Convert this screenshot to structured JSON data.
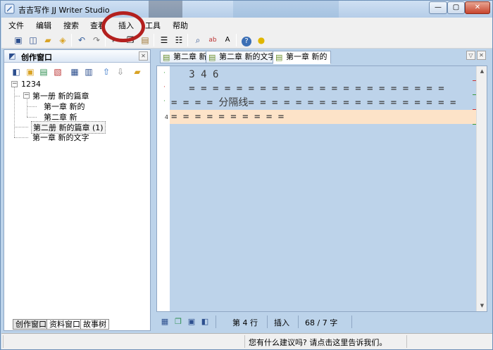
{
  "app": {
    "title": "吉吉写作 JJ Writer Studio"
  },
  "menu": [
    "文件",
    "编辑",
    "搜索",
    "查看",
    "插入",
    "工具",
    "帮助"
  ],
  "creation_panel": {
    "title": "创作窗口",
    "tree": {
      "root": "1234",
      "volume1": "第一册 新的篇章",
      "v1_chapter1": "第一章 新的",
      "v1_chapter2": "第二章 新",
      "volume2": "第二册 新的篇章 (1)",
      "chapter_loose": "第一章 新的文字"
    },
    "bottom_tabs": [
      "创作窗口",
      "资料窗口",
      "故事树"
    ]
  },
  "doc_tabs": [
    "第二章 新",
    "第二章 新的文字",
    "第一章 新的"
  ],
  "editor": {
    "lines": [
      "   3 4 6",
      "   = = = = = = = = = = = = = = = = = = = = = =",
      "= = = = 分隔线= = = = = = = = = = = = = = = = = =",
      "= = = = = = = = = ="
    ],
    "current_line_number": "4"
  },
  "status": {
    "line": "第 4 行",
    "mode": "插入",
    "count": "68 / 7 字"
  },
  "footer": {
    "message": "您有什么建议吗? 请点击这里告诉我们。"
  },
  "colors": {
    "annotation_circle": "#b3201e",
    "editor_bg": "#bdd3ea",
    "current_line": "#fde3c8"
  }
}
